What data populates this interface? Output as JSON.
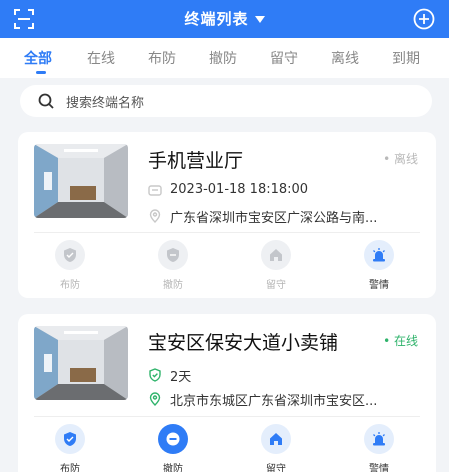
{
  "header": {
    "title": "终端列表",
    "scan_icon": "scan-icon",
    "add_icon": "plus-circle-icon"
  },
  "tabs": [
    {
      "label": "全部",
      "active": true
    },
    {
      "label": "在线"
    },
    {
      "label": "布防"
    },
    {
      "label": "撤防"
    },
    {
      "label": "留守"
    },
    {
      "label": "离线"
    },
    {
      "label": "到期"
    }
  ],
  "search": {
    "placeholder": "搜索终端名称"
  },
  "devices": [
    {
      "name": "手机营业厅",
      "status": "• 离线",
      "time": "2023-01-18 18:18:00",
      "address": "广东省深圳市宝安区广深公路与南...",
      "actions": {
        "arm": "布防",
        "disarm": "撤防",
        "stay": "留守",
        "alarm": "警情"
      }
    },
    {
      "name": "宝安区保安大道小卖铺",
      "status": "• 在线",
      "duration": "2天",
      "address": "北京市东城区广东省深圳市宝安区...",
      "actions": {
        "arm": "布防",
        "disarm": "撤防",
        "stay": "留守",
        "alarm": "警情"
      }
    }
  ],
  "colors": {
    "primary": "#2f7cf6",
    "online": "#2fb36b",
    "offline": "#b9b9b9"
  }
}
